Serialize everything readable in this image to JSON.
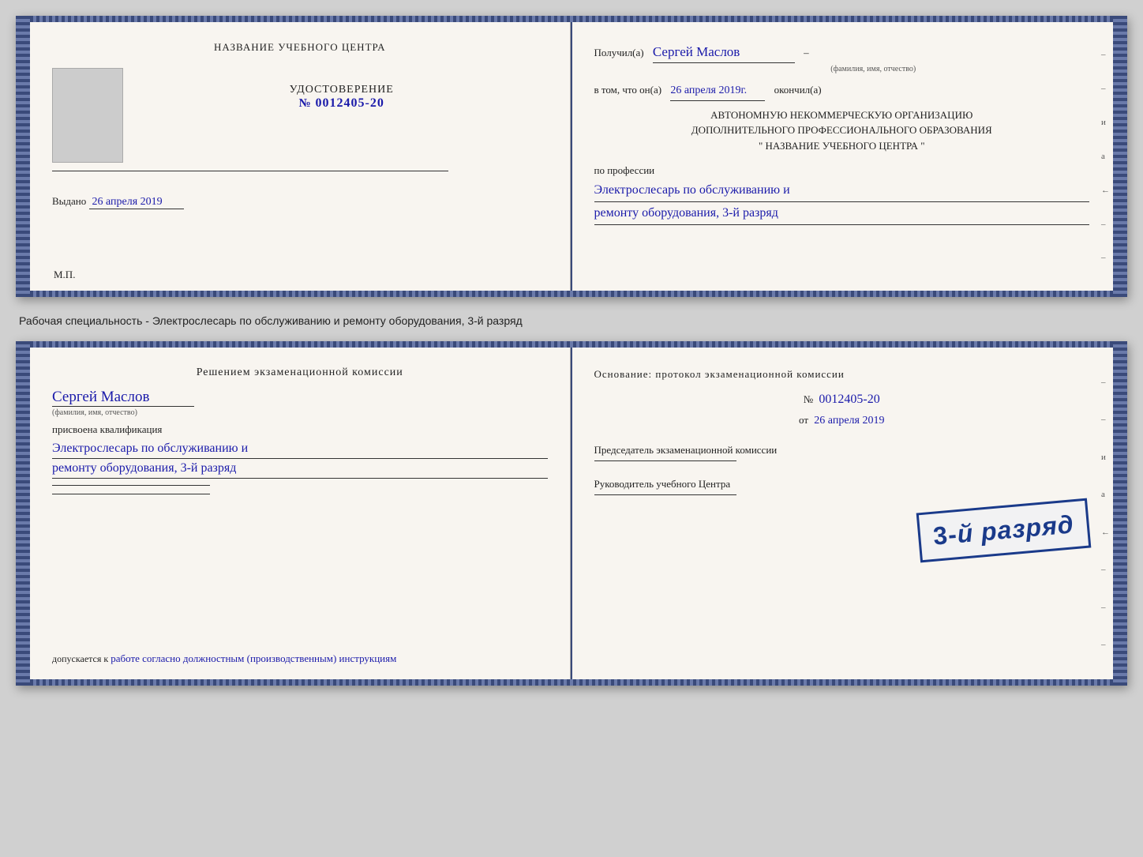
{
  "top_booklet": {
    "left_page": {
      "training_center_label": "НАЗВАНИЕ УЧЕБНОГО ЦЕНТРА",
      "certificate_label": "УДОСТОВЕРЕНИЕ",
      "number_prefix": "№",
      "number": "0012405-20",
      "issued_label": "Выдано",
      "issued_date": "26 апреля 2019",
      "mp_label": "М.П."
    },
    "right_page": {
      "received_label": "Получил(а)",
      "recipient_name": "Сергей Маслов",
      "name_sublabel": "(фамилия, имя, отчество)",
      "dash": "–",
      "in_that_label": "в том, что он(а)",
      "date_completed": "26 апреля 2019г.",
      "finished_label": "окончил(а)",
      "org_line1": "АВТОНОМНУЮ НЕКОММЕРЧЕСКУЮ ОРГАНИЗАЦИЮ",
      "org_line2": "ДОПОЛНИТЕЛЬНОГО ПРОФЕССИОНАЛЬНОГО ОБРАЗОВАНИЯ",
      "org_quote_open": "\"",
      "org_name": "НАЗВАНИЕ УЧЕБНОГО ЦЕНТРА",
      "org_quote_close": "\"",
      "profession_label": "по профессии",
      "profession_line1": "Электрослесарь по обслуживанию и",
      "profession_line2": "ремонту оборудования, 3-й разряд"
    }
  },
  "description": "Рабочая специальность - Электрослесарь по обслуживанию и ремонту оборудования, 3-й разряд",
  "bottom_booklet": {
    "left_page": {
      "decision_label": "Решением экзаменационной комиссии",
      "recipient_name": "Сергей Маслов",
      "name_sublabel": "(фамилия, имя, отчество)",
      "assigned_label": "присвоена квалификация",
      "qualification_line1": "Электрослесарь по обслуживанию и",
      "qualification_line2": "ремонту оборудования, 3-й разряд",
      "admitted_label": "допускается к",
      "admitted_text": "работе согласно должностным (производственным) инструкциям"
    },
    "right_page": {
      "basis_label": "Основание: протокол экзаменационной комиссии",
      "number_prefix": "№",
      "protocol_number": "0012405-20",
      "from_label": "от",
      "protocol_date": "26 апреля 2019",
      "chairman_label": "Председатель экзаменационной комиссии",
      "rukovoditel_label": "Руководитель учебного Центра"
    },
    "stamp": {
      "line1": "3-й разряд"
    }
  },
  "side_letters": {
    "right": [
      "и",
      "а",
      "←",
      "–",
      "–",
      "–"
    ]
  }
}
